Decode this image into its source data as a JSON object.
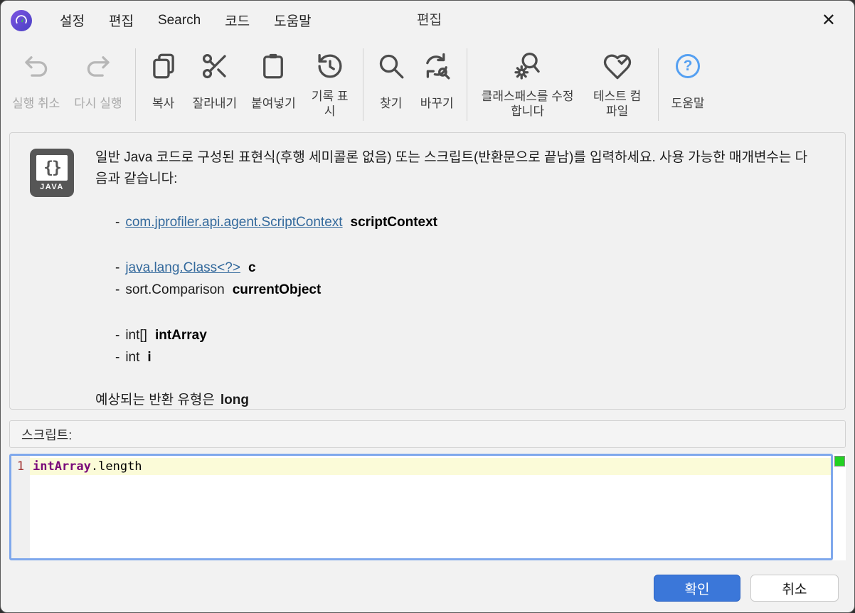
{
  "colors": {
    "accent_blue": "#3b77d9",
    "help_blue": "#55a0f2",
    "link_blue": "#33699c",
    "keyword_purple": "#7a0a7a",
    "line_number_red": "#a03030",
    "current_line_yellow": "#fbfbd8",
    "focus_border_blue": "#7fa8ec",
    "status_green": "#22d122"
  },
  "titlebar": {
    "menus": [
      "설정",
      "편집",
      "Search",
      "코드",
      "도움말"
    ],
    "window_title": "편집",
    "close_glyph": "✕"
  },
  "toolbar": {
    "undo": "실행 취소",
    "redo": "다시 실행",
    "copy": "복사",
    "cut": "잘라내기",
    "paste": "붙여넣기",
    "history": "기록 표시",
    "find": "찾기",
    "replace": "바꾸기",
    "classpath": "클래스패스를 수정합니다",
    "test_compile": "테스트 컴파일",
    "help": "도움말",
    "help_glyph": "?"
  },
  "info": {
    "java_braces": "{}",
    "java_label": "JAVA",
    "intro": "일반 Java 코드로 구성된 표현식(후행 세미콜론 없음) 또는 스크립트(반환문으로 끝남)를 입력하세요. 사용 가능한 매개변수는 다음과 같습니다:",
    "bullet": "-",
    "parameters": [
      {
        "type": "com.jprofiler.api.agent.ScriptContext",
        "name": "scriptContext"
      },
      {
        "type": "java.lang.Class<?>",
        "name": "c"
      },
      {
        "type": "sort.Comparison",
        "name": "currentObject"
      },
      {
        "type": "int[]",
        "name": "intArray"
      },
      {
        "type": "int",
        "name": "i"
      }
    ],
    "return_prefix": "예상되는 반환 유형은",
    "return_type": "long"
  },
  "script_panel": {
    "label": "스크립트:"
  },
  "editor": {
    "line_number": "1",
    "code_object": "intArray",
    "code_member": ".length"
  },
  "footer": {
    "ok_label": "확인",
    "cancel_label": "취소"
  }
}
